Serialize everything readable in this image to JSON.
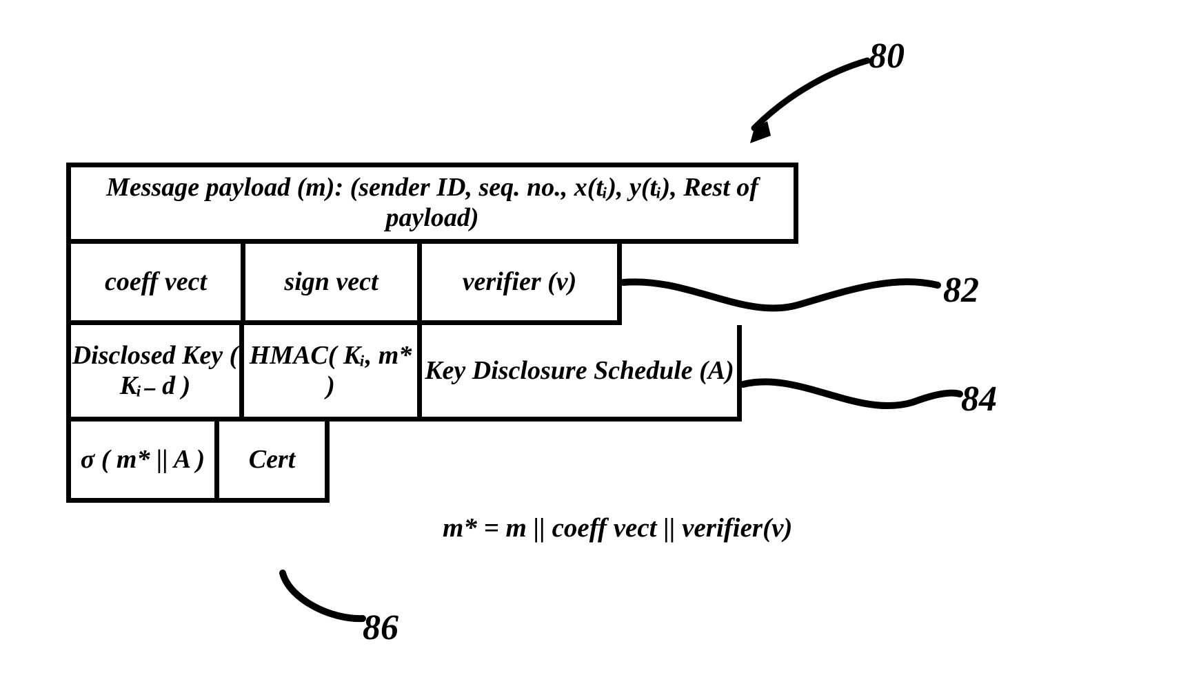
{
  "labels": {
    "l80": "80",
    "l82": "82",
    "l84": "84",
    "l86": "86"
  },
  "rows": {
    "r1": {
      "c1": "Message payload (m): (sender ID, seq. no., x(tᵢ), y(tᵢ), Rest of payload)"
    },
    "r2": {
      "c1": "coeff vect",
      "c2": "sign vect",
      "c3": "verifier (v)"
    },
    "r3": {
      "c1": "Disclosed Key ( Kᵢ₋ d )",
      "c2": "HMAC( Kᵢ, m* )",
      "c3": "Key Disclosure Schedule (A)"
    },
    "r4": {
      "c1": "σ  ( m* || A )",
      "c2": "Cert"
    }
  },
  "note": "m* = m || coeff vect || verifier(v)"
}
